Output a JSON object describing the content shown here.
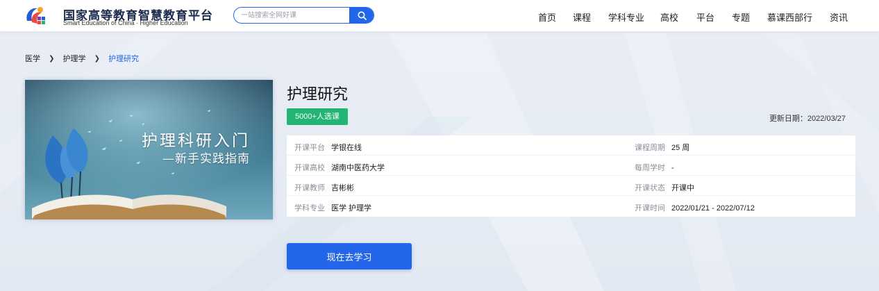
{
  "header": {
    "brand_title": "国家高等教育智慧教育平台",
    "brand_subtitle": "Smart Education of China · Higher Education",
    "search_placeholder": "一站搜索全网好课",
    "nav": [
      "首页",
      "课程",
      "学科专业",
      "高校",
      "平台",
      "专题",
      "慕课西部行",
      "资讯"
    ]
  },
  "breadcrumb": {
    "items": [
      "医学",
      "护理学"
    ],
    "current": "护理研究"
  },
  "course": {
    "cover": {
      "line1": "护理科研入门",
      "line2": "—新手实践指南"
    },
    "title": "护理研究",
    "enroll_badge": "5000+人选课",
    "update_date": "更新日期：2022/03/27",
    "info": {
      "platform": {
        "label": "开课平台",
        "value": "学银在线"
      },
      "school": {
        "label": "开课高校",
        "value": "湖南中医药大学"
      },
      "teacher": {
        "label": "开课教师",
        "value": "吉彬彬"
      },
      "subject": {
        "label": "学科专业",
        "value": "医学 护理学"
      },
      "period": {
        "label": "课程周期",
        "value": "25 周"
      },
      "weekly_hours": {
        "label": "每周学时",
        "value": "-"
      },
      "status": {
        "label": "开课状态",
        "value": "开课中"
      },
      "time": {
        "label": "开课时间",
        "value": "2022/01/21 - 2022/07/12"
      }
    },
    "study_button": "现在去学习"
  },
  "colors": {
    "accent": "#2466e8",
    "badge_green": "#22b573",
    "background": "#e6ecf4"
  }
}
